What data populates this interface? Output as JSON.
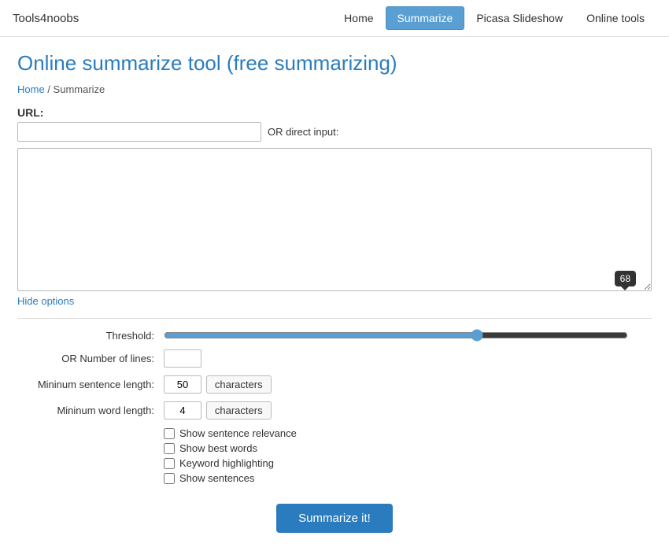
{
  "brand": "Tools4noobs",
  "nav": {
    "links": [
      {
        "id": "home",
        "label": "Home",
        "active": false
      },
      {
        "id": "summarize",
        "label": "Summarize",
        "active": true
      },
      {
        "id": "picasa",
        "label": "Picasa Slideshow",
        "active": false
      },
      {
        "id": "online-tools",
        "label": "Online tools",
        "active": false
      }
    ]
  },
  "page": {
    "title": "Online summarize tool (free summarizing)",
    "breadcrumb_home": "Home",
    "breadcrumb_current": "Summarize"
  },
  "form": {
    "url_label": "URL:",
    "url_placeholder": "",
    "or_direct_label": "OR direct input:",
    "textarea_placeholder": "",
    "hide_options_label": "Hide options",
    "threshold_label": "Threshold:",
    "threshold_value": 68,
    "threshold_slider_value": 68,
    "or_lines_label": "OR Number of lines:",
    "lines_value": "",
    "min_sentence_label": "Mininum sentence length:",
    "min_sentence_value": "50",
    "min_word_label": "Mininum word length:",
    "min_word_value": "4",
    "characters_label": "characters",
    "characters_label2": "characters",
    "checkbox_show_relevance": "Show sentence relevance",
    "checkbox_show_best": "Show best words",
    "checkbox_keyword": "Keyword highlighting",
    "checkbox_show_sentences": "Show sentences",
    "submit_label": "Summarize it!"
  }
}
